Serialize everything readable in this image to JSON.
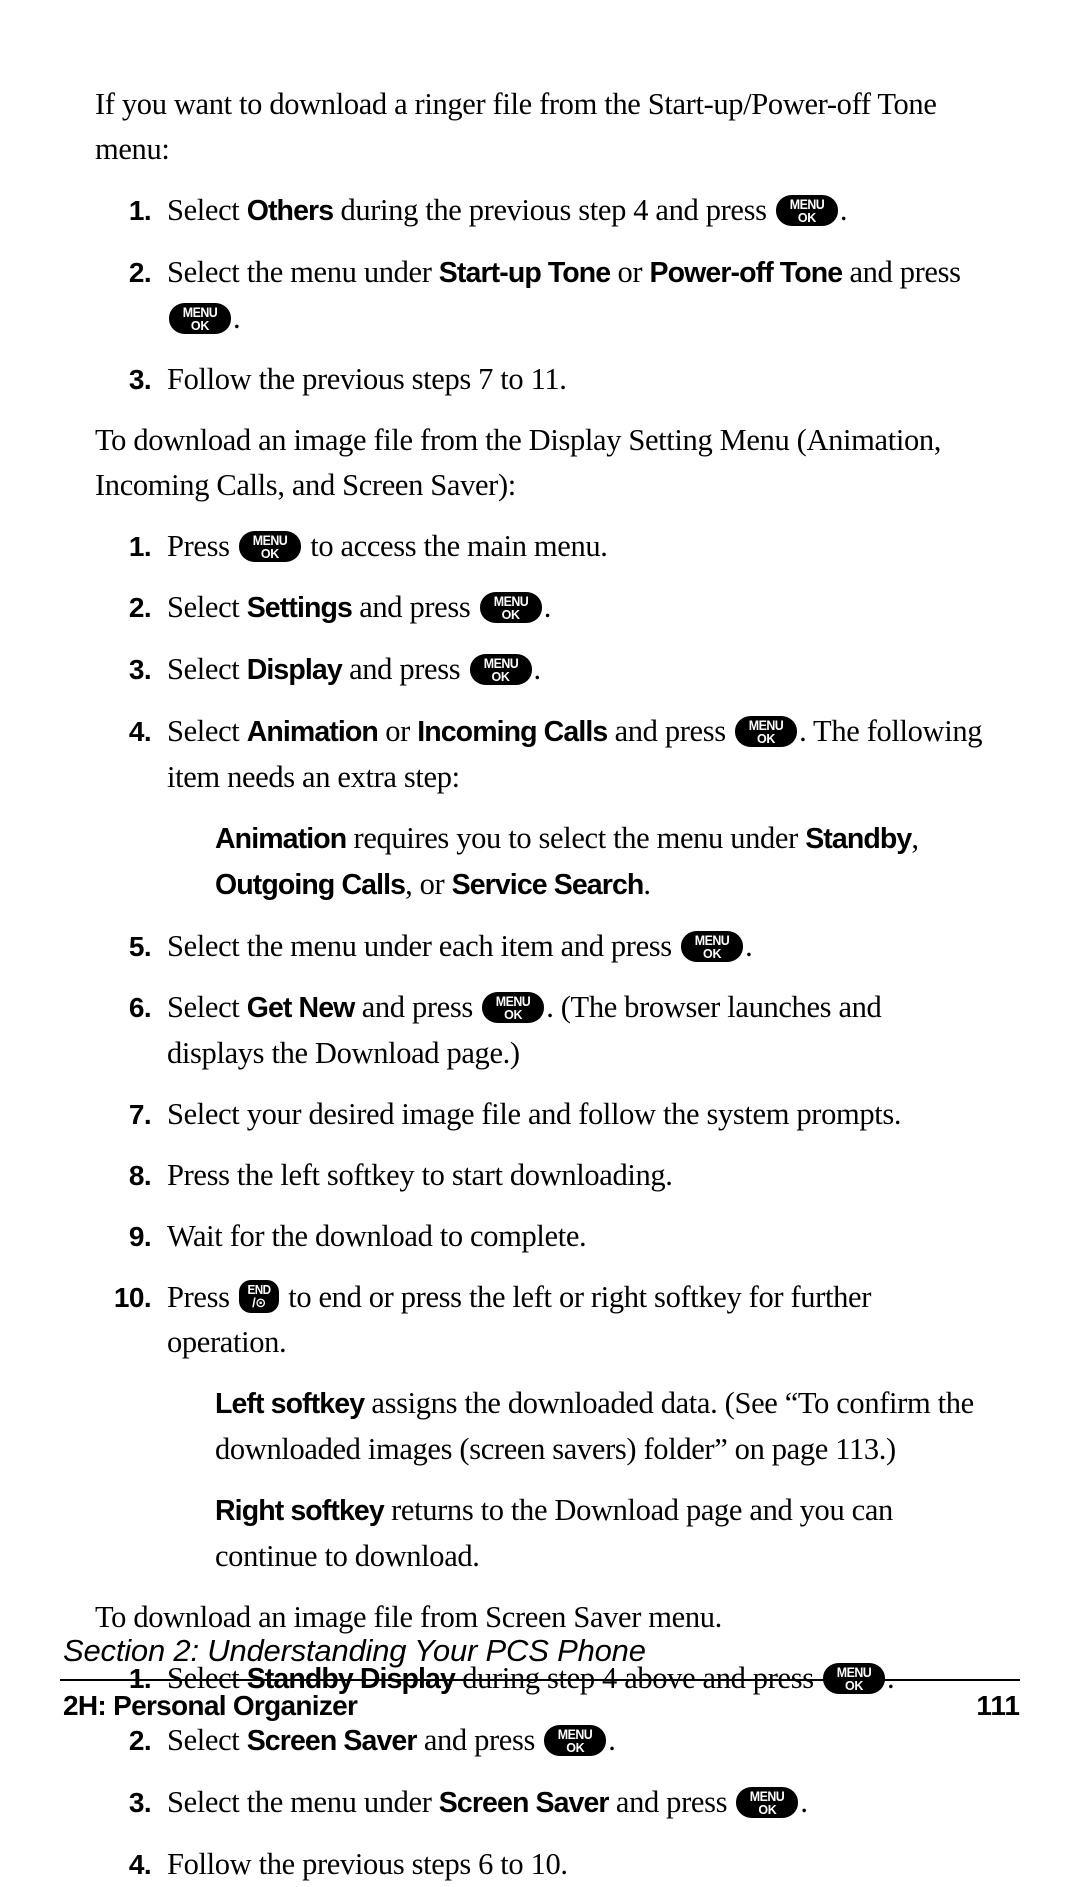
{
  "document": {
    "intro": {
      "text_part1": "If you want to download a ringer file from the Start-up/Power-off Tone menu:"
    },
    "list1": {
      "items": [
        {
          "num": "1.",
          "seg": [
            {
              "t": "Select ",
              "b": false
            },
            {
              "t": "Others",
              "b": true
            },
            {
              "t": " during the previous step 4 and press ",
              "b": false
            },
            {
              "key": "menu-ok"
            },
            {
              "t": ".",
              "b": false
            }
          ]
        },
        {
          "num": "2.",
          "seg": [
            {
              "t": "Select the menu under ",
              "b": false
            },
            {
              "t": "Start-up Tone",
              "b": true
            },
            {
              "t": " or ",
              "b": false
            },
            {
              "t": "Power-off Tone",
              "b": true
            },
            {
              "t": " and press ",
              "b": false
            },
            {
              "key": "menu-ok"
            },
            {
              "t": ".",
              "b": false
            }
          ]
        },
        {
          "num": "3.",
          "seg": [
            {
              "t": "Follow the previous steps 7 to 11.",
              "b": false
            }
          ]
        }
      ]
    },
    "para2": {
      "text": "To download an image file from the Display Setting Menu (Animation, Incoming Calls, and Screen Saver):"
    },
    "list2": {
      "items": [
        {
          "num": "1.",
          "seg": [
            {
              "t": "Press ",
              "b": false
            },
            {
              "key": "menu-ok"
            },
            {
              "t": " to access the main menu.",
              "b": false
            }
          ]
        },
        {
          "num": "2.",
          "seg": [
            {
              "t": "Select ",
              "b": false
            },
            {
              "t": "Settings",
              "b": true
            },
            {
              "t": " and press ",
              "b": false
            },
            {
              "key": "menu-ok"
            },
            {
              "t": ".",
              "b": false
            }
          ]
        },
        {
          "num": "3.",
          "seg": [
            {
              "t": "Select ",
              "b": false
            },
            {
              "t": "Display",
              "b": true
            },
            {
              "t": " and press ",
              "b": false
            },
            {
              "key": "menu-ok"
            },
            {
              "t": ".",
              "b": false
            }
          ]
        },
        {
          "num": "4.",
          "seg": [
            {
              "t": "Select ",
              "b": false
            },
            {
              "t": "Animation",
              "b": true
            },
            {
              "t": " or ",
              "b": false
            },
            {
              "t": "Incoming Calls",
              "b": true
            },
            {
              "t": " and press ",
              "b": false
            },
            {
              "key": "menu-ok"
            },
            {
              "t": ". The following item needs an extra step:",
              "b": false
            }
          ]
        }
      ]
    },
    "note1": {
      "seg": [
        {
          "t": "Animation",
          "b": true
        },
        {
          "t": " requires you to select the menu under ",
          "b": false
        },
        {
          "t": "Standby",
          "b": true
        },
        {
          "t": ", ",
          "b": false
        },
        {
          "t": "Outgoing Calls",
          "b": true
        },
        {
          "t": ", or ",
          "b": false
        },
        {
          "t": "Service Search",
          "b": true
        },
        {
          "t": ".",
          "b": false
        }
      ]
    },
    "list2b": {
      "items": [
        {
          "num": "5.",
          "seg": [
            {
              "t": "Select the menu under each item and press ",
              "b": false
            },
            {
              "key": "menu-ok"
            },
            {
              "t": ".",
              "b": false
            }
          ]
        },
        {
          "num": "6.",
          "seg": [
            {
              "t": "Select ",
              "b": false
            },
            {
              "t": "Get New",
              "b": true
            },
            {
              "t": " and press ",
              "b": false
            },
            {
              "key": "menu-ok"
            },
            {
              "t": ". (The browser launches and displays the Download page.)",
              "b": false
            }
          ]
        },
        {
          "num": "7.",
          "seg": [
            {
              "t": "Select your desired image file and follow the system prompts.",
              "b": false
            }
          ]
        },
        {
          "num": "8.",
          "seg": [
            {
              "t": "Press the left softkey to start downloading.",
              "b": false
            }
          ]
        },
        {
          "num": "9.",
          "seg": [
            {
              "t": "Wait for the download to complete.",
              "b": false
            }
          ]
        },
        {
          "num": "10.",
          "seg": [
            {
              "t": "Press ",
              "b": false
            },
            {
              "key": "end"
            },
            {
              "t": " to end or press the left or right softkey for further operation.",
              "b": false
            }
          ]
        }
      ]
    },
    "note2": {
      "seg": [
        {
          "t": "Left softkey",
          "b": true
        },
        {
          "t": " assigns the downloaded data. (See “To confirm the downloaded images (screen savers) folder” on page 113.)",
          "b": false
        }
      ]
    },
    "note3": {
      "seg": [
        {
          "t": "Right softkey",
          "b": true
        },
        {
          "t": " returns to the Download page and you can continue to download.",
          "b": false
        }
      ]
    },
    "para3": {
      "text": "To download an image file from Screen Saver menu."
    },
    "list3": {
      "items": [
        {
          "num": "1.",
          "seg": [
            {
              "t": "Select ",
              "b": false
            },
            {
              "t": "Standby Display",
              "b": true
            },
            {
              "t": " during step 4 above and press ",
              "b": false
            },
            {
              "key": "menu-ok"
            },
            {
              "t": ".",
              "b": false
            }
          ]
        },
        {
          "num": "2.",
          "seg": [
            {
              "t": "Select ",
              "b": false
            },
            {
              "t": "Screen Saver",
              "b": true
            },
            {
              "t": " and press ",
              "b": false
            },
            {
              "key": "menu-ok"
            },
            {
              "t": ".",
              "b": false
            }
          ]
        },
        {
          "num": "3.",
          "seg": [
            {
              "t": "Select the menu under ",
              "b": false
            },
            {
              "t": "Screen Saver",
              "b": true
            },
            {
              "t": " and press ",
              "b": false
            },
            {
              "key": "menu-ok"
            },
            {
              "t": ".",
              "b": false
            }
          ]
        },
        {
          "num": "4.",
          "seg": [
            {
              "t": "Follow the previous steps 6 to 10.",
              "b": false
            }
          ]
        }
      ]
    },
    "footer": {
      "section": "Section 2: Understanding Your PCS Phone",
      "chapter": "2H: Personal Organizer",
      "page_number": "111"
    },
    "keys": {
      "menu-ok": {
        "line1": "MENU",
        "line2": "OK",
        "name": "menu-ok-key-icon"
      },
      "end": {
        "line1": "END",
        "line2": "/⊙",
        "name": "end-power-key-icon"
      }
    },
    "colors": {
      "text": "#000000",
      "background": "#ffffff",
      "key_fill": "#000000",
      "key_label": "#ffffff"
    }
  }
}
